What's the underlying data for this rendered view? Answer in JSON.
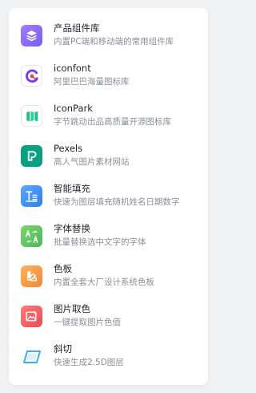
{
  "plugins": [
    {
      "title": "产品组件库",
      "desc": "内置PC端和移动端的常用组件库",
      "icon": "layers-icon",
      "color": "#8b6cf5"
    },
    {
      "title": "iconfont",
      "desc": "阿里巴巴海量图标库",
      "icon": "iconfont-logo-icon",
      "color": "#7a3cf0"
    },
    {
      "title": "IconPark",
      "desc": "字节跳动出品高质量开源图标库",
      "icon": "iconpark-logo-icon",
      "color": "#1fbf86"
    },
    {
      "title": "Pexels",
      "desc": "高人气图片素材网站",
      "icon": "pexels-logo-icon",
      "color": "#07a081"
    },
    {
      "title": "智能填充",
      "desc": "快速为图层填充随机姓名日期数字",
      "icon": "text-fill-icon",
      "color": "#3b8ef0"
    },
    {
      "title": "字体替换",
      "desc": "批量替换选中文字的字体",
      "icon": "font-replace-icon",
      "color": "#5fc46a"
    },
    {
      "title": "色板",
      "desc": "内置全套大厂设计系统色板",
      "icon": "palette-icon",
      "color": "#f39b48"
    },
    {
      "title": "图片取色",
      "desc": "一键提取图片色值",
      "icon": "image-color-picker-icon",
      "color": "#ef5d63"
    },
    {
      "title": "斜切",
      "desc": "快速生成2.5D图层",
      "icon": "skew-icon",
      "color": "#45a9ec"
    }
  ]
}
